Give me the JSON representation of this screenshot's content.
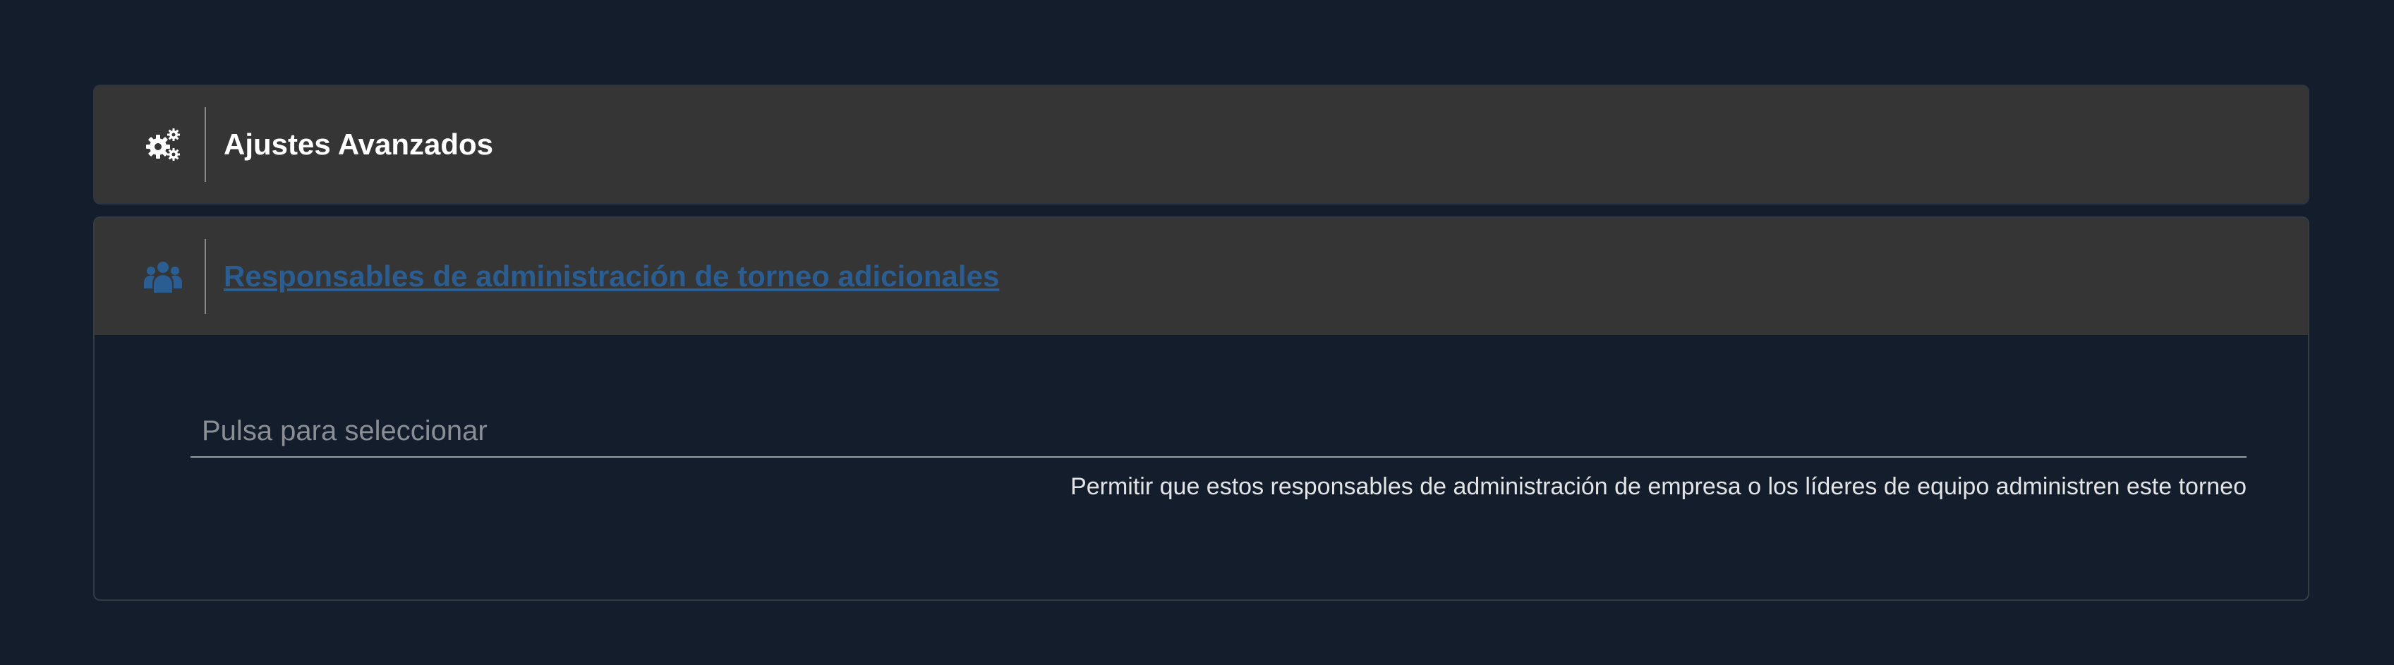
{
  "colors": {
    "background": "#141d2b",
    "panel_header": "#353535",
    "link": "#2a5d92",
    "title": "#ffffff",
    "placeholder": "#8a8f95",
    "hint": "#e2e4e6"
  },
  "advanced_settings": {
    "icon": "cogs-icon",
    "title": "Ajustes Avanzados"
  },
  "tournament_managers": {
    "icon": "users-icon",
    "title": " Responsables de administración de torneo adicionales",
    "select": {
      "placeholder": "Pulsa para seleccionar",
      "hint": "Permitir que estos responsables de administración de empresa o los líderes de equipo administren este torneo"
    }
  }
}
